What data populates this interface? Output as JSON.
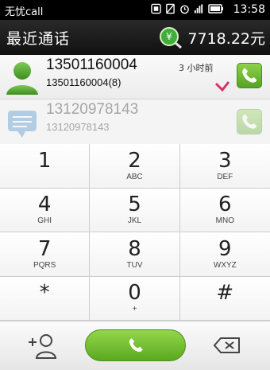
{
  "status_bar": {
    "carrier": "无忧call",
    "time": "13:58"
  },
  "header": {
    "title": "最近通话",
    "balance": "7718.22元"
  },
  "call_log": [
    {
      "number": "13501160004",
      "detail": "13501160004(8)",
      "time_ago": "3 小时前"
    },
    {
      "number": "13120978143",
      "detail": "13120978143",
      "time_ago": ""
    }
  ],
  "keypad": {
    "keys": [
      {
        "digit": "1",
        "letters": ""
      },
      {
        "digit": "2",
        "letters": "ABC"
      },
      {
        "digit": "3",
        "letters": "DEF"
      },
      {
        "digit": "4",
        "letters": "GHI"
      },
      {
        "digit": "5",
        "letters": "JKL"
      },
      {
        "digit": "6",
        "letters": "MNO"
      },
      {
        "digit": "7",
        "letters": "PQRS"
      },
      {
        "digit": "8",
        "letters": "TUV"
      },
      {
        "digit": "9",
        "letters": "WXYZ"
      },
      {
        "digit": "*",
        "letters": ""
      },
      {
        "digit": "0",
        "letters": "+"
      },
      {
        "digit": "#",
        "letters": ""
      }
    ]
  },
  "icons": {
    "add_contact": "add-contact-icon",
    "dial": "phone-icon",
    "backspace": "backspace-icon"
  },
  "colors": {
    "accent_green": "#6cbf2f",
    "missed_call": "#d4336a"
  }
}
